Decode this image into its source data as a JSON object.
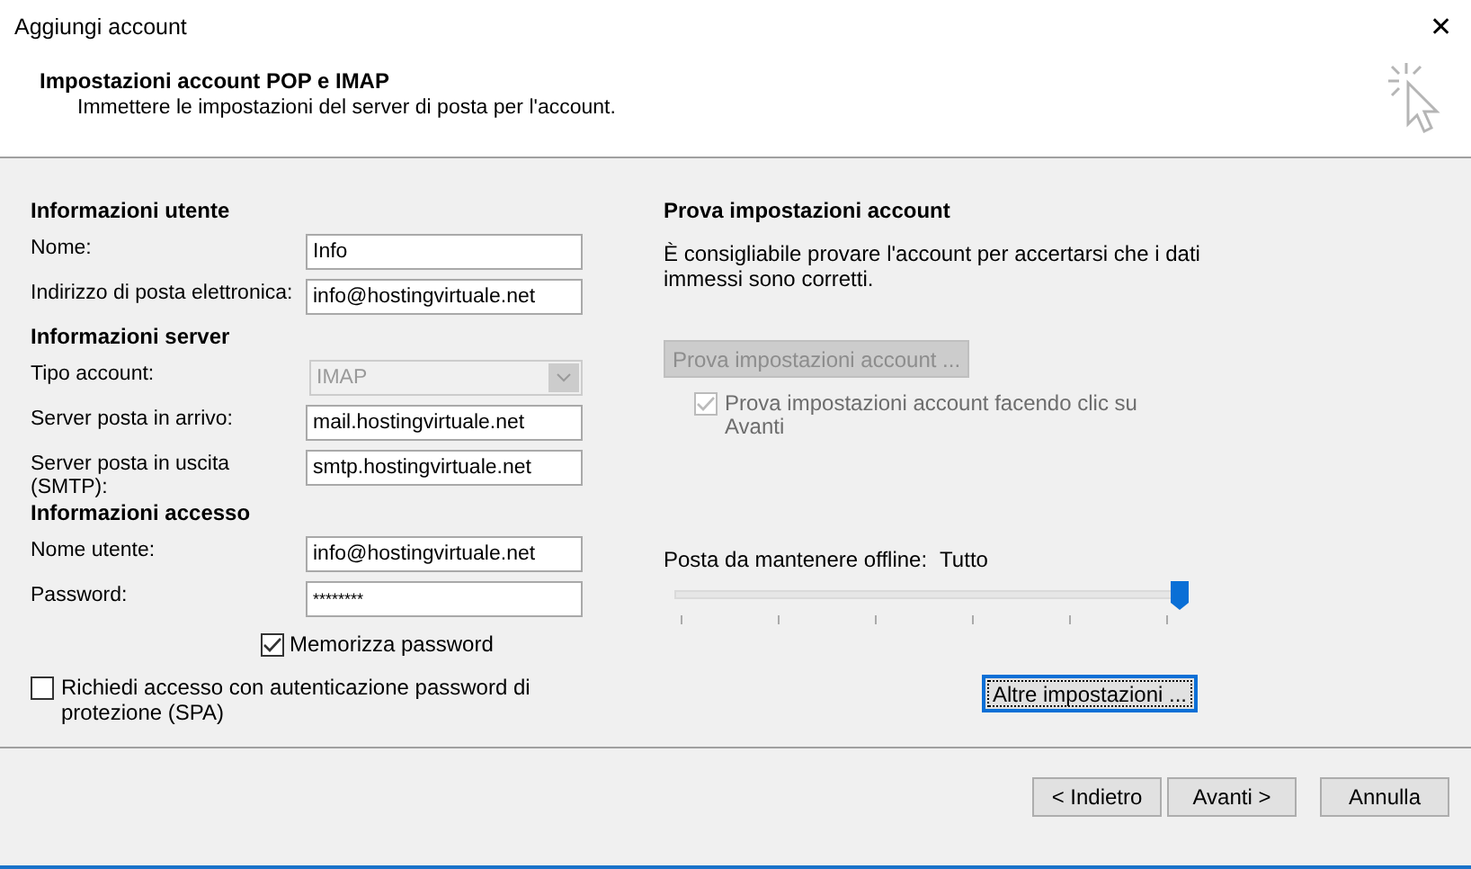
{
  "window": {
    "title": "Aggiungi account",
    "close": "✕"
  },
  "header": {
    "title": "Impostazioni account POP e IMAP",
    "subtitle": "Immettere le impostazioni del server di posta per l'account."
  },
  "sections": [
    {
      "heading": "Informazioni utente",
      "fields": [
        {
          "kind": "text",
          "label": "Nome:",
          "value": "Info",
          "disabled": false
        },
        {
          "kind": "text",
          "label": "Indirizzo di posta elettronica:",
          "value": "info@hostingvirtuale.net",
          "disabled": false
        }
      ]
    },
    {
      "heading": "Informazioni server",
      "fields": [
        {
          "kind": "select",
          "label": "Tipo account:",
          "value": "IMAP",
          "disabled": true
        },
        {
          "kind": "text",
          "label": "Server posta in arrivo:",
          "value": "mail.hostingvirtuale.net",
          "disabled": false
        },
        {
          "kind": "text",
          "label": "Server posta in uscita (SMTP):",
          "value": "smtp.hostingvirtuale.net",
          "disabled": false
        }
      ]
    },
    {
      "heading": "Informazioni accesso",
      "fields": [
        {
          "kind": "text",
          "label": "Nome utente:",
          "value": "info@hostingvirtuale.net",
          "disabled": false
        },
        {
          "kind": "password",
          "label": "Password:",
          "value": "********",
          "disabled": false
        }
      ]
    }
  ],
  "remember_password": {
    "label": "Memorizza password",
    "checked": true
  },
  "spa": {
    "label": "Richiedi accesso con autenticazione password di protezione (SPA)",
    "checked": false
  },
  "test": {
    "heading": "Prova impostazioni account",
    "text": "È consigliabile provare l'account per accertarsi che i dati immessi sono corretti.",
    "button": {
      "label": "Prova impostazioni account ...",
      "disabled": true
    },
    "checkbox": {
      "label": "Prova impostazioni account facendo clic su Avanti",
      "checked": true,
      "disabled": true
    }
  },
  "offline": {
    "label": "Posta da mantenere offline:",
    "value": "Tutto",
    "level": 1
  },
  "more_button": "Altre impostazioni ...",
  "buttons": [
    "< Indietro",
    "Avanti >",
    "Annulla"
  ]
}
